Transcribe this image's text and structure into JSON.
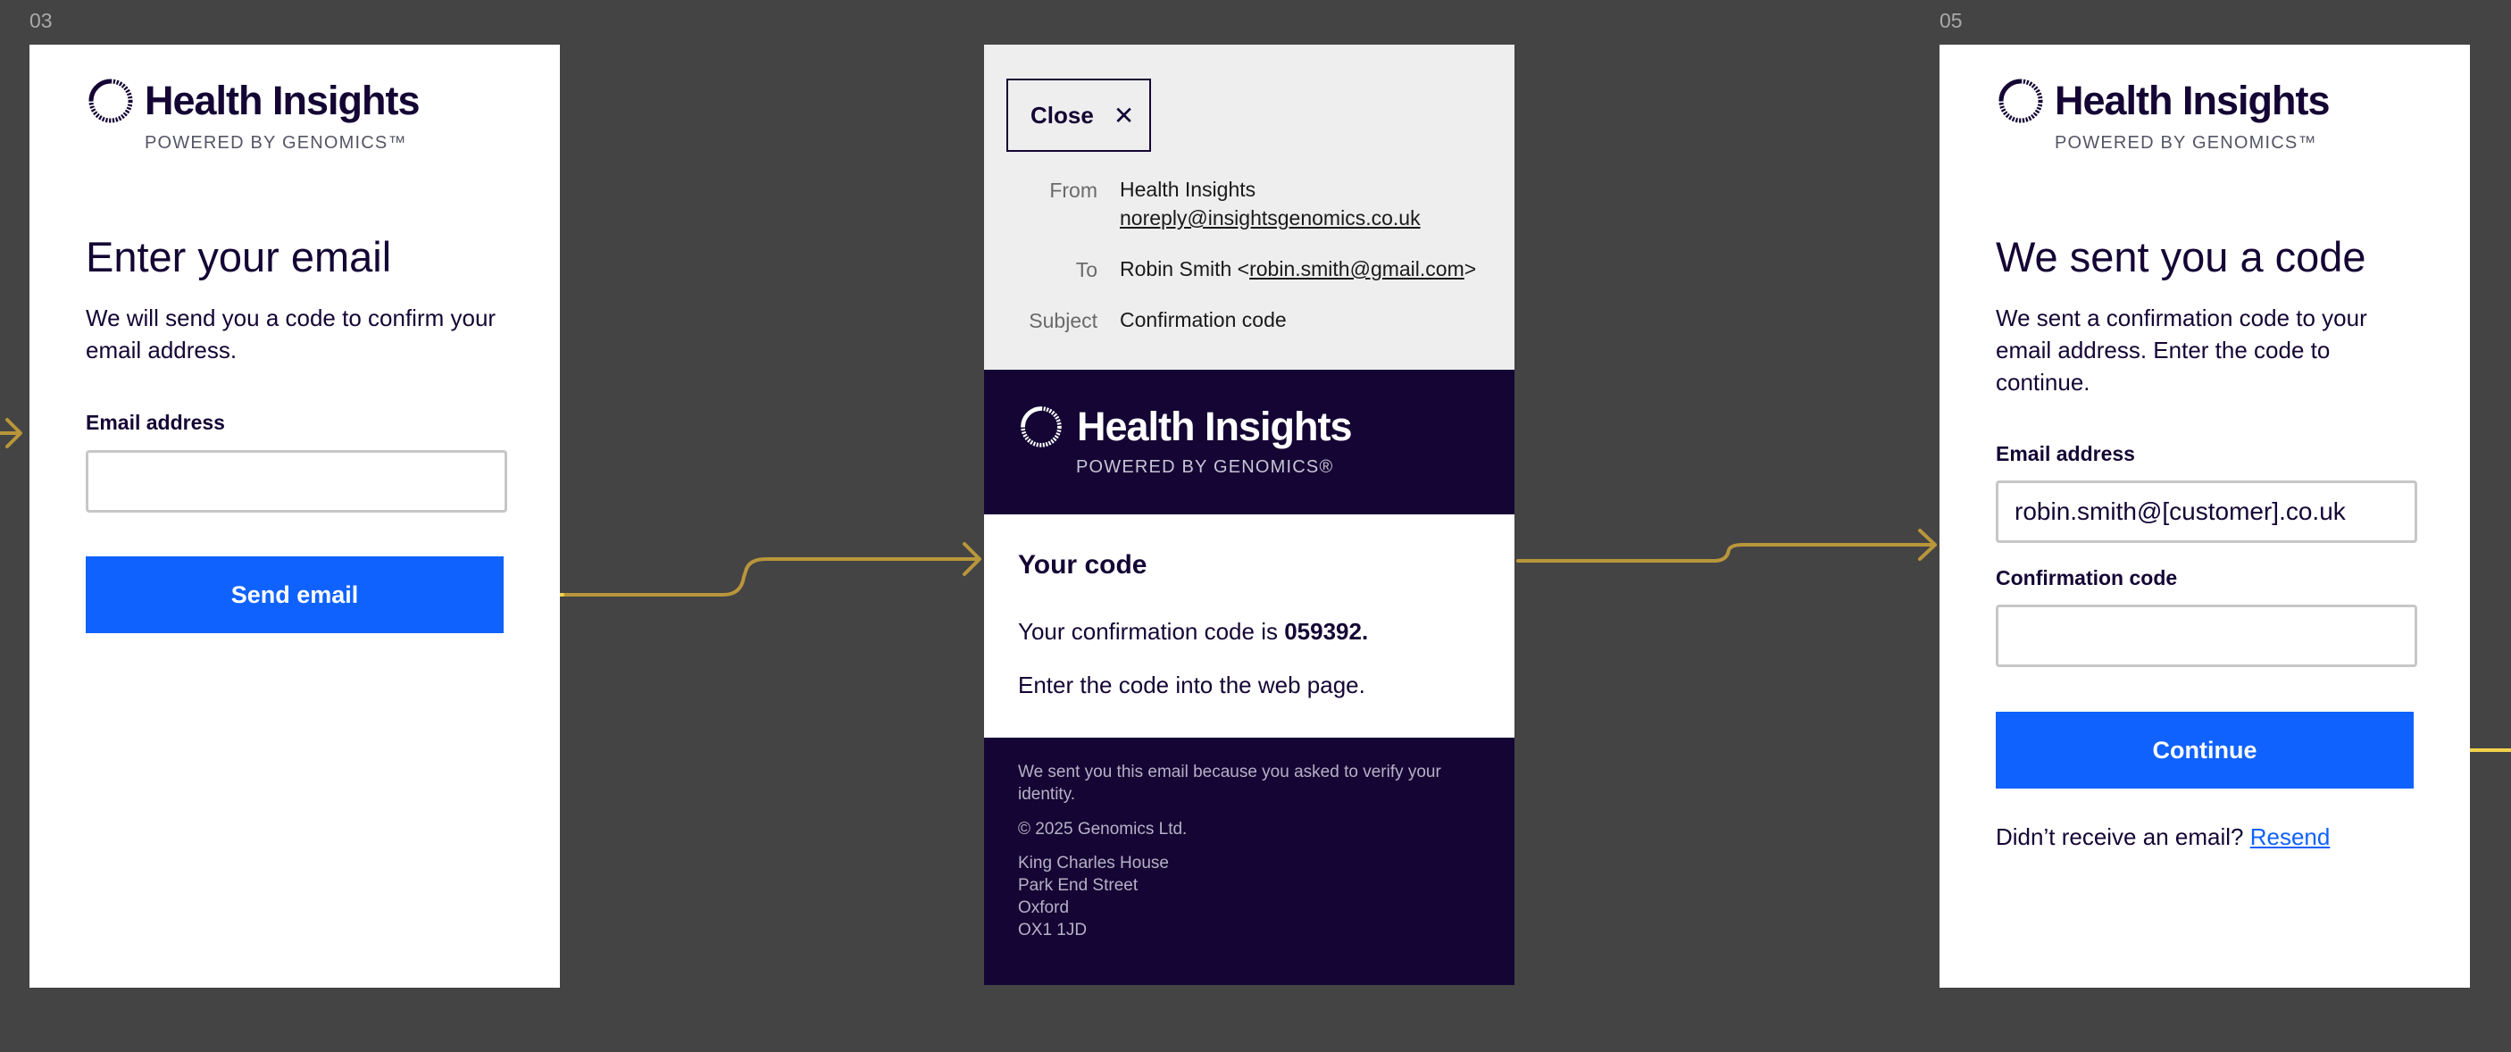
{
  "brand": {
    "name": "Health Insights",
    "tagline": "POWERED BY GENOMICS™",
    "tagline_email": "POWERED BY GENOMICS®"
  },
  "colors": {
    "background": "#444444",
    "navy": "#140534",
    "primary": "#0f62fe",
    "connector": "#b9963a",
    "connector_light": "#f2d24b"
  },
  "frames": {
    "left_number": "03",
    "right_number": "05"
  },
  "screen_enter_email": {
    "heading": "Enter your email",
    "description": "We will send you a code to confirm your email address.",
    "email_label": "Email address",
    "email_value": "",
    "send_button": "Send email"
  },
  "email": {
    "close_label": "Close",
    "close_icon": "close-icon",
    "from_label": "From",
    "from_name": "Health Insights",
    "from_address": "noreply@insightsgenomics.co.uk",
    "to_label": "To",
    "to_name_prefix": "Robin Smith <",
    "to_address": "robin.smith@gmail.com",
    "to_suffix": ">",
    "subject_label": "Subject",
    "subject": "Confirmation code",
    "body_title": "Your code",
    "code_prefix": "Your confirmation code is ",
    "code": "059392.",
    "instruction": "Enter the code into the web page.",
    "footer_reason": "We sent you this email because you asked to verify your identity.",
    "copyright": "© 2025 Genomics Ltd.",
    "address": [
      "King Charles House",
      "Park End Street",
      "Oxford",
      "OX1 1JD"
    ]
  },
  "screen_code": {
    "heading": "We sent you a code",
    "description": "We sent a confirmation code to your email address. Enter the code to continue.",
    "email_label": "Email address",
    "email_value": "robin.smith@[customer].co.uk",
    "code_label": "Confirmation code",
    "code_value": "",
    "continue_button": "Continue",
    "resend_prompt": "Didn’t receive an email?",
    "resend_link": "Resend"
  }
}
